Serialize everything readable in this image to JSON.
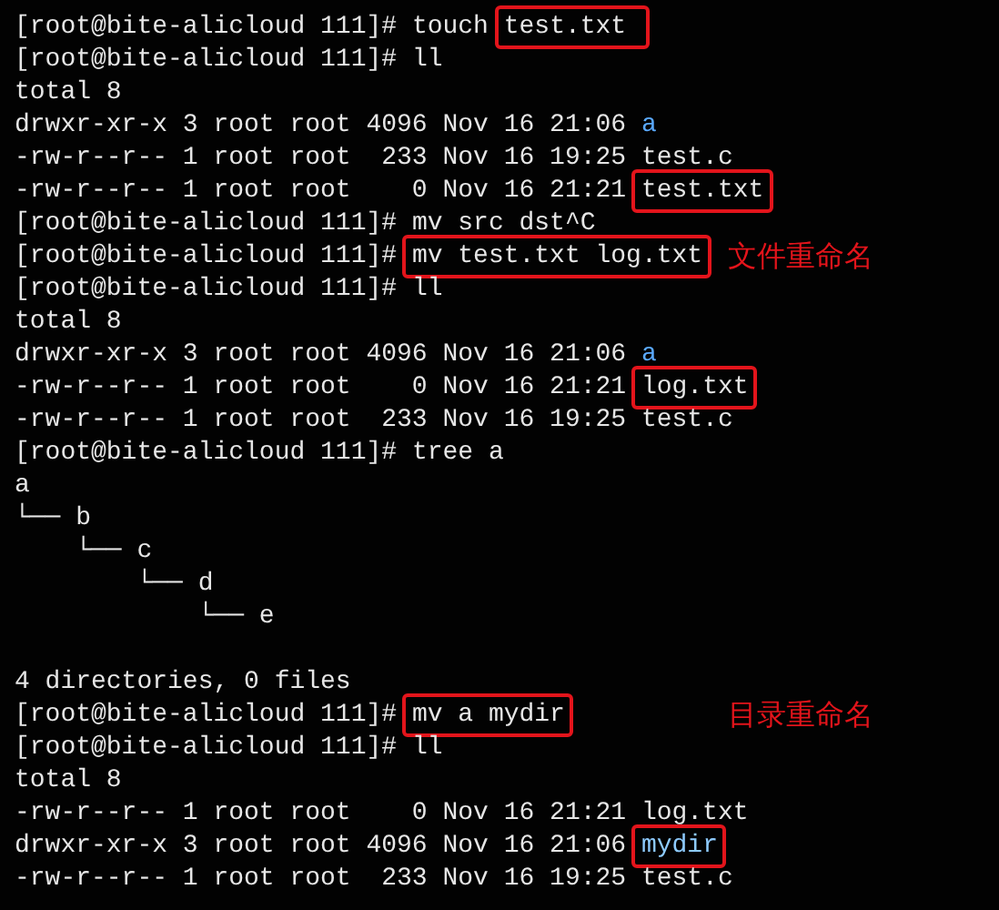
{
  "terminal": {
    "lines": [
      {
        "kind": "line",
        "segments": [
          {
            "kind": "prompt",
            "text": "[root@bite-alicloud 111]# "
          },
          {
            "kind": "text",
            "text": "touch "
          },
          {
            "kind": "boxed",
            "text": "test.txt "
          }
        ]
      },
      {
        "kind": "line",
        "segments": [
          {
            "kind": "prompt",
            "text": "[root@bite-alicloud 111]# "
          },
          {
            "kind": "text",
            "text": "ll"
          }
        ]
      },
      {
        "kind": "line",
        "segments": [
          {
            "kind": "text",
            "text": "total 8"
          }
        ]
      },
      {
        "kind": "line",
        "segments": [
          {
            "kind": "text",
            "text": "drwxr-xr-x 3 root root 4096 Nov 16 21:06 "
          },
          {
            "kind": "dir",
            "text": "a"
          }
        ]
      },
      {
        "kind": "line",
        "segments": [
          {
            "kind": "text",
            "text": "-rw-r--r-- 1 root root  233 Nov 16 19:25 test.c"
          }
        ]
      },
      {
        "kind": "line",
        "segments": [
          {
            "kind": "text",
            "text": "-rw-r--r-- 1 root root    0 Nov 16 21:21 "
          },
          {
            "kind": "boxed",
            "text": "test.txt"
          }
        ]
      },
      {
        "kind": "line",
        "segments": [
          {
            "kind": "prompt",
            "text": "[root@bite-alicloud 111]# "
          },
          {
            "kind": "text",
            "text": "mv src dst^C"
          }
        ]
      },
      {
        "kind": "line",
        "segments": [
          {
            "kind": "prompt",
            "text": "[root@bite-alicloud 111]# "
          },
          {
            "kind": "boxed",
            "text": "mv test.txt log.txt"
          }
        ],
        "note": "文件重命名"
      },
      {
        "kind": "line",
        "segments": [
          {
            "kind": "prompt",
            "text": "[root@bite-alicloud 111]# "
          },
          {
            "kind": "text",
            "text": "ll"
          }
        ]
      },
      {
        "kind": "line",
        "segments": [
          {
            "kind": "text",
            "text": "total 8"
          }
        ]
      },
      {
        "kind": "line",
        "segments": [
          {
            "kind": "text",
            "text": "drwxr-xr-x 3 root root 4096 Nov 16 21:06 "
          },
          {
            "kind": "dir",
            "text": "a"
          }
        ]
      },
      {
        "kind": "line",
        "segments": [
          {
            "kind": "text",
            "text": "-rw-r--r-- 1 root root    0 Nov 16 21:21 "
          },
          {
            "kind": "boxed",
            "text": "log.txt"
          }
        ]
      },
      {
        "kind": "line",
        "segments": [
          {
            "kind": "text",
            "text": "-rw-r--r-- 1 root root  233 Nov 16 19:25 test.c"
          }
        ]
      },
      {
        "kind": "line",
        "segments": [
          {
            "kind": "prompt",
            "text": "[root@bite-alicloud 111]# "
          },
          {
            "kind": "text",
            "text": "tree a"
          }
        ]
      },
      {
        "kind": "line",
        "segments": [
          {
            "kind": "text",
            "text": "a"
          }
        ]
      },
      {
        "kind": "line",
        "segments": [
          {
            "kind": "text",
            "text": "└── b"
          }
        ]
      },
      {
        "kind": "line",
        "segments": [
          {
            "kind": "text",
            "text": "    └── c"
          }
        ]
      },
      {
        "kind": "line",
        "segments": [
          {
            "kind": "text",
            "text": "        └── d"
          }
        ]
      },
      {
        "kind": "line",
        "segments": [
          {
            "kind": "text",
            "text": "            └── e"
          }
        ]
      },
      {
        "kind": "blank"
      },
      {
        "kind": "line",
        "segments": [
          {
            "kind": "text",
            "text": "4 directories, 0 files"
          }
        ]
      },
      {
        "kind": "line",
        "segments": [
          {
            "kind": "prompt",
            "text": "[root@bite-alicloud 111]# "
          },
          {
            "kind": "boxed",
            "text": "mv a mydir"
          }
        ],
        "note": "目录重命名"
      },
      {
        "kind": "line",
        "segments": [
          {
            "kind": "prompt",
            "text": "[root@bite-alicloud 111]# "
          },
          {
            "kind": "text",
            "text": "ll"
          }
        ]
      },
      {
        "kind": "line",
        "segments": [
          {
            "kind": "text",
            "text": "total 8"
          }
        ]
      },
      {
        "kind": "line",
        "segments": [
          {
            "kind": "text",
            "text": "-rw-r--r-- 1 root root    0 Nov 16 21:21 log.txt"
          }
        ]
      },
      {
        "kind": "line",
        "segments": [
          {
            "kind": "text",
            "text": "drwxr-xr-x 3 root root 4096 Nov 16 21:06 "
          },
          {
            "kind": "boxed-dir",
            "text": "mydir"
          }
        ]
      },
      {
        "kind": "line",
        "segments": [
          {
            "kind": "text",
            "text": "-rw-r--r-- 1 root root  233 Nov 16 19:25 test.c"
          }
        ]
      }
    ]
  }
}
